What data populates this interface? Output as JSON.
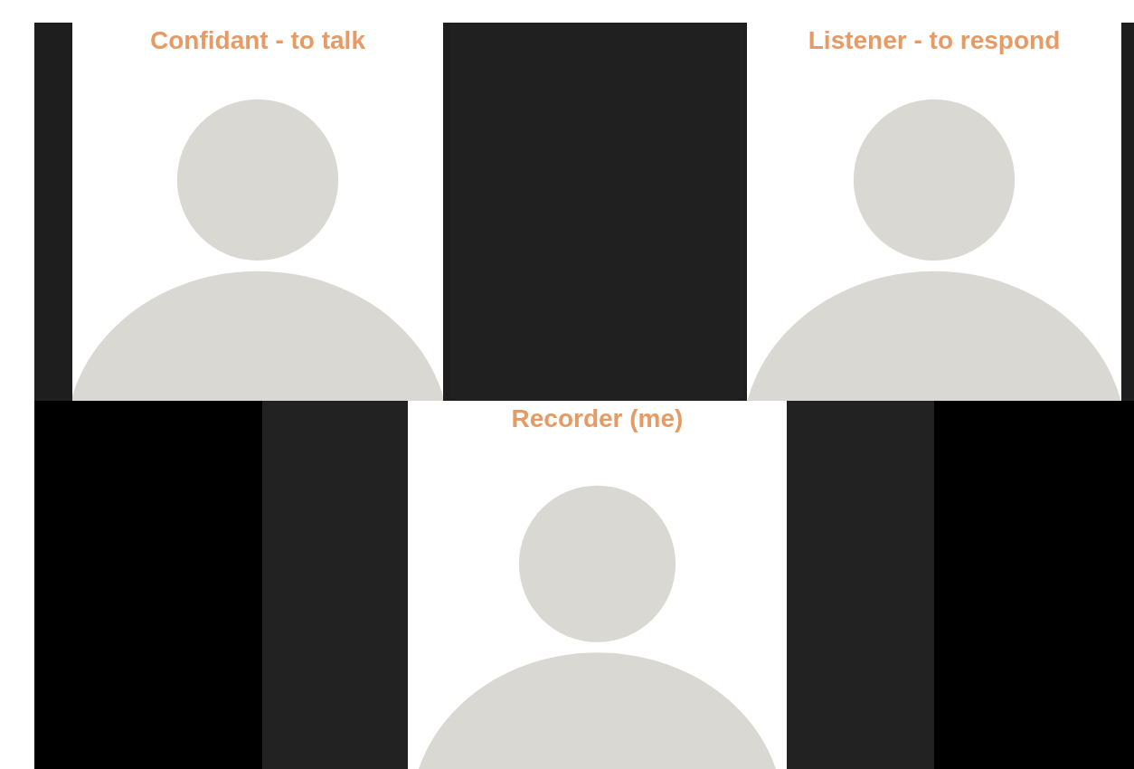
{
  "top_row": [
    {
      "kind": "avatar",
      "label": "Confidant - to talk"
    },
    {
      "kind": "blank"
    },
    {
      "kind": "avatar",
      "label": "Listener - to respond"
    }
  ],
  "bottom_row": [
    {
      "kind": "avatar",
      "label": "Recorder (me)"
    }
  ]
}
